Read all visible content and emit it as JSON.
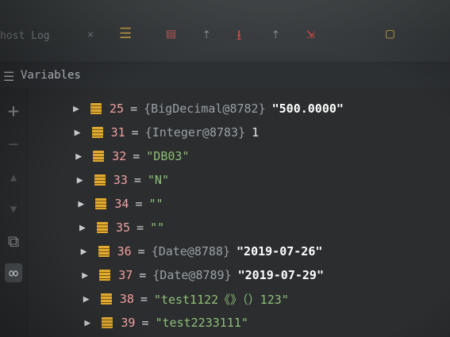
{
  "toolbar": {
    "tab_label": "host Log",
    "close_glyph": "×",
    "buttons": [
      {
        "name": "layout-icon",
        "glyph": "☰",
        "color": "#c9a54a"
      },
      {
        "name": "frames-icon",
        "glyph": "▤",
        "color": "#b05858"
      },
      {
        "name": "step-over-icon",
        "glyph": "⇡",
        "color": "#8a8f93"
      },
      {
        "name": "step-into-icon",
        "glyph": "⭳",
        "color": "#d64a4a"
      },
      {
        "name": "step-out-icon",
        "glyph": "⇡",
        "color": "#8a8f93"
      },
      {
        "name": "run-to-cursor-icon",
        "glyph": "⇲",
        "color": "#d64a4a"
      },
      {
        "name": "evaluate-icon",
        "glyph": "▢",
        "color": "#b8a24a"
      }
    ]
  },
  "panel": {
    "title": "Variables",
    "header_icon": "☰"
  },
  "sidebar": [
    {
      "name": "add-watch-icon",
      "glyph": "+"
    },
    {
      "name": "remove-watch-icon",
      "glyph": "−"
    },
    {
      "name": "move-up-icon",
      "glyph": "▲"
    },
    {
      "name": "move-down-icon",
      "glyph": "▼"
    },
    {
      "name": "copy-icon",
      "glyph": "⧉"
    },
    {
      "name": "watches-icon",
      "glyph": "∞",
      "active": true
    }
  ],
  "variables": [
    {
      "index": "25",
      "parts": [
        {
          "t": "ref",
          "v": "{BigDecimal@8782}"
        },
        {
          "t": "strw",
          "v": "\"500.0000\""
        }
      ]
    },
    {
      "index": "31",
      "parts": [
        {
          "t": "ref",
          "v": "{Integer@8783}"
        },
        {
          "t": "num",
          "v": "1"
        }
      ]
    },
    {
      "index": "32",
      "parts": [
        {
          "t": "str",
          "v": "\"DB03\""
        }
      ]
    },
    {
      "index": "33",
      "parts": [
        {
          "t": "str",
          "v": "\"N\""
        }
      ]
    },
    {
      "index": "34",
      "parts": [
        {
          "t": "str",
          "v": "\"\""
        }
      ]
    },
    {
      "index": "35",
      "parts": [
        {
          "t": "str",
          "v": "\"\""
        }
      ]
    },
    {
      "index": "36",
      "parts": [
        {
          "t": "ref",
          "v": "{Date@8788}"
        },
        {
          "t": "strw",
          "v": "\"2019-07-26\""
        }
      ]
    },
    {
      "index": "37",
      "parts": [
        {
          "t": "ref",
          "v": "{Date@8789}"
        },
        {
          "t": "strw",
          "v": "\"2019-07-29\""
        }
      ]
    },
    {
      "index": "38",
      "parts": [
        {
          "t": "str",
          "v": "\"test1122《》（）123\""
        }
      ]
    },
    {
      "index": "39",
      "parts": [
        {
          "t": "str",
          "v": "\"test2233111\""
        }
      ]
    }
  ],
  "equals_sign": "="
}
